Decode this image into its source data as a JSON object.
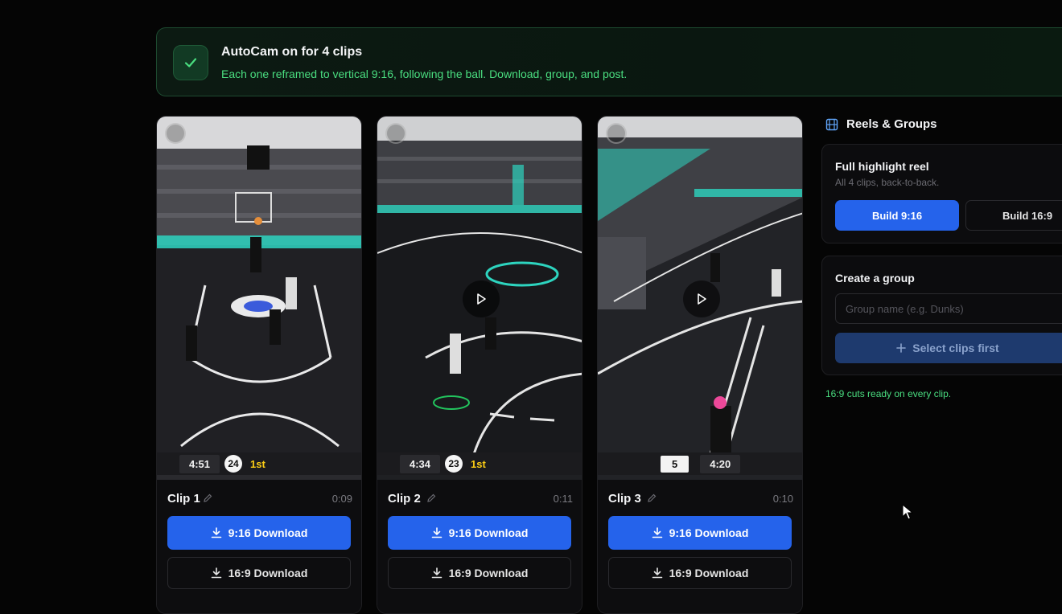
{
  "banner": {
    "title": "AutoCam on for 4 clips",
    "subtitle": "Each one reframed to vertical 9:16, following the ball. Download, group, and post."
  },
  "clips": [
    {
      "name": "Clip 1",
      "duration": "0:09",
      "clock": "4:51",
      "shot_clock": "24",
      "period": "1st",
      "primary_btn": "9:16 Download",
      "secondary_btn": "16:9 Download"
    },
    {
      "name": "Clip 2",
      "duration": "0:11",
      "clock": "4:34",
      "shot_clock": "23",
      "period": "1st",
      "primary_btn": "9:16 Download",
      "secondary_btn": "16:9 Download"
    },
    {
      "name": "Clip 3",
      "duration": "0:10",
      "clock": "4:20",
      "score": "5",
      "primary_btn": "9:16 Download",
      "secondary_btn": "16:9 Download"
    }
  ],
  "sidebar": {
    "title": "Reels & Groups",
    "reel": {
      "title": "Full highlight reel",
      "desc": "All 4 clips, back-to-back.",
      "build_916": "Build 9:16",
      "build_169": "Build 16:9"
    },
    "group": {
      "title": "Create a group",
      "placeholder": "Group name (e.g. Dunks)",
      "action": "Select clips first"
    },
    "note": "16:9 cuts ready on every clip."
  },
  "colors": {
    "accent": "#2563eb",
    "success": "#4ade80",
    "court_teal": "#2dd4bf"
  },
  "icons": [
    "check-icon",
    "film-icon",
    "download-icon",
    "pencil-icon",
    "play-icon",
    "plus-icon",
    "cursor-icon"
  ]
}
